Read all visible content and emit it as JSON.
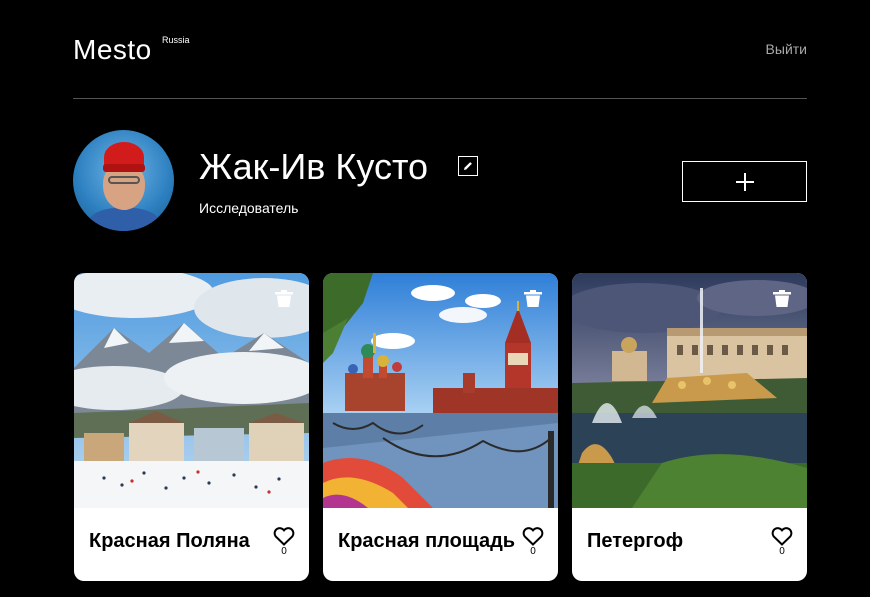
{
  "header": {
    "logo": "Mesto",
    "logo_sup": "Russia",
    "logout_label": "Выйти"
  },
  "profile": {
    "name": "Жак-Ив Кусто",
    "about": "Исследователь",
    "edit_icon": "pencil-icon",
    "add_icon": "plus-icon"
  },
  "cards": [
    {
      "title": "Красная Поляна",
      "likes": "0",
      "image": "mountain-ski-resort"
    },
    {
      "title": "Красная площадь",
      "likes": "0",
      "image": "red-square-moscow"
    },
    {
      "title": "Петергоф",
      "likes": "0",
      "image": "peterhof-fountains"
    }
  ],
  "colors": {
    "background": "#000000",
    "card": "#ffffff",
    "divider": "#545454",
    "muted_text": "#a9a9a9"
  }
}
